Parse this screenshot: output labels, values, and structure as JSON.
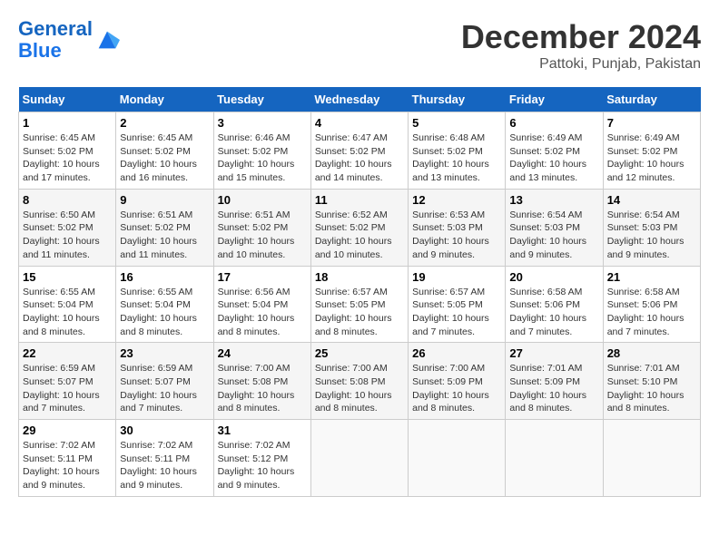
{
  "header": {
    "logo_line1": "General",
    "logo_line2": "Blue",
    "month": "December 2024",
    "location": "Pattoki, Punjab, Pakistan"
  },
  "days_of_week": [
    "Sunday",
    "Monday",
    "Tuesday",
    "Wednesday",
    "Thursday",
    "Friday",
    "Saturday"
  ],
  "weeks": [
    [
      {
        "day": "1",
        "sunrise": "6:45 AM",
        "sunset": "5:02 PM",
        "daylight": "10 hours and 17 minutes."
      },
      {
        "day": "2",
        "sunrise": "6:45 AM",
        "sunset": "5:02 PM",
        "daylight": "10 hours and 16 minutes."
      },
      {
        "day": "3",
        "sunrise": "6:46 AM",
        "sunset": "5:02 PM",
        "daylight": "10 hours and 15 minutes."
      },
      {
        "day": "4",
        "sunrise": "6:47 AM",
        "sunset": "5:02 PM",
        "daylight": "10 hours and 14 minutes."
      },
      {
        "day": "5",
        "sunrise": "6:48 AM",
        "sunset": "5:02 PM",
        "daylight": "10 hours and 13 minutes."
      },
      {
        "day": "6",
        "sunrise": "6:49 AM",
        "sunset": "5:02 PM",
        "daylight": "10 hours and 13 minutes."
      },
      {
        "day": "7",
        "sunrise": "6:49 AM",
        "sunset": "5:02 PM",
        "daylight": "10 hours and 12 minutes."
      }
    ],
    [
      {
        "day": "8",
        "sunrise": "6:50 AM",
        "sunset": "5:02 PM",
        "daylight": "10 hours and 11 minutes."
      },
      {
        "day": "9",
        "sunrise": "6:51 AM",
        "sunset": "5:02 PM",
        "daylight": "10 hours and 11 minutes."
      },
      {
        "day": "10",
        "sunrise": "6:51 AM",
        "sunset": "5:02 PM",
        "daylight": "10 hours and 10 minutes."
      },
      {
        "day": "11",
        "sunrise": "6:52 AM",
        "sunset": "5:02 PM",
        "daylight": "10 hours and 10 minutes."
      },
      {
        "day": "12",
        "sunrise": "6:53 AM",
        "sunset": "5:03 PM",
        "daylight": "10 hours and 9 minutes."
      },
      {
        "day": "13",
        "sunrise": "6:54 AM",
        "sunset": "5:03 PM",
        "daylight": "10 hours and 9 minutes."
      },
      {
        "day": "14",
        "sunrise": "6:54 AM",
        "sunset": "5:03 PM",
        "daylight": "10 hours and 9 minutes."
      }
    ],
    [
      {
        "day": "15",
        "sunrise": "6:55 AM",
        "sunset": "5:04 PM",
        "daylight": "10 hours and 8 minutes."
      },
      {
        "day": "16",
        "sunrise": "6:55 AM",
        "sunset": "5:04 PM",
        "daylight": "10 hours and 8 minutes."
      },
      {
        "day": "17",
        "sunrise": "6:56 AM",
        "sunset": "5:04 PM",
        "daylight": "10 hours and 8 minutes."
      },
      {
        "day": "18",
        "sunrise": "6:57 AM",
        "sunset": "5:05 PM",
        "daylight": "10 hours and 8 minutes."
      },
      {
        "day": "19",
        "sunrise": "6:57 AM",
        "sunset": "5:05 PM",
        "daylight": "10 hours and 7 minutes."
      },
      {
        "day": "20",
        "sunrise": "6:58 AM",
        "sunset": "5:06 PM",
        "daylight": "10 hours and 7 minutes."
      },
      {
        "day": "21",
        "sunrise": "6:58 AM",
        "sunset": "5:06 PM",
        "daylight": "10 hours and 7 minutes."
      }
    ],
    [
      {
        "day": "22",
        "sunrise": "6:59 AM",
        "sunset": "5:07 PM",
        "daylight": "10 hours and 7 minutes."
      },
      {
        "day": "23",
        "sunrise": "6:59 AM",
        "sunset": "5:07 PM",
        "daylight": "10 hours and 7 minutes."
      },
      {
        "day": "24",
        "sunrise": "7:00 AM",
        "sunset": "5:08 PM",
        "daylight": "10 hours and 8 minutes."
      },
      {
        "day": "25",
        "sunrise": "7:00 AM",
        "sunset": "5:08 PM",
        "daylight": "10 hours and 8 minutes."
      },
      {
        "day": "26",
        "sunrise": "7:00 AM",
        "sunset": "5:09 PM",
        "daylight": "10 hours and 8 minutes."
      },
      {
        "day": "27",
        "sunrise": "7:01 AM",
        "sunset": "5:09 PM",
        "daylight": "10 hours and 8 minutes."
      },
      {
        "day": "28",
        "sunrise": "7:01 AM",
        "sunset": "5:10 PM",
        "daylight": "10 hours and 8 minutes."
      }
    ],
    [
      {
        "day": "29",
        "sunrise": "7:02 AM",
        "sunset": "5:11 PM",
        "daylight": "10 hours and 9 minutes."
      },
      {
        "day": "30",
        "sunrise": "7:02 AM",
        "sunset": "5:11 PM",
        "daylight": "10 hours and 9 minutes."
      },
      {
        "day": "31",
        "sunrise": "7:02 AM",
        "sunset": "5:12 PM",
        "daylight": "10 hours and 9 minutes."
      },
      null,
      null,
      null,
      null
    ]
  ]
}
